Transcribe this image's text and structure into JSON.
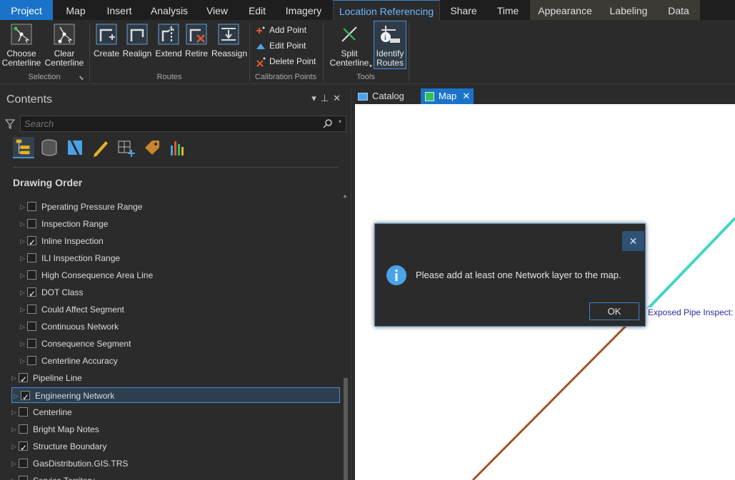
{
  "ribbon_tabs": [
    "Project",
    "Map",
    "Insert",
    "Analysis",
    "View",
    "Edit",
    "Imagery",
    "Location Referencing",
    "Share",
    "Time",
    "Appearance",
    "Labeling",
    "Data"
  ],
  "ribbon": {
    "selection": {
      "label": "Selection",
      "choose_centerline": "Choose\nCenterline",
      "clear_centerline": "Clear\nCenterline"
    },
    "routes": {
      "label": "Routes",
      "create": "Create",
      "realign": "Realign",
      "extend": "Extend",
      "retire": "Retire",
      "reassign": "Reassign"
    },
    "calibration": {
      "label": "Calibration Points",
      "add_point": "Add Point",
      "edit_point": "Edit Point",
      "delete_point": "Delete Point"
    },
    "tools": {
      "label": "Tools",
      "split_centerline": "Split\nCenterline",
      "identify_routes": "Identify\nRoutes"
    }
  },
  "contents": {
    "title": "Contents",
    "search_placeholder": "Search",
    "drawing_order": "Drawing Order",
    "layers": [
      {
        "name": "Pperating Pressure Range",
        "checked": false,
        "indent": 1
      },
      {
        "name": "Inspection Range",
        "checked": false,
        "indent": 1
      },
      {
        "name": "Inline Inspection",
        "checked": true,
        "indent": 1
      },
      {
        "name": "ILI Inspection Range",
        "checked": false,
        "indent": 1
      },
      {
        "name": "High Consequence Area Line",
        "checked": false,
        "indent": 1
      },
      {
        "name": "DOT Class",
        "checked": true,
        "indent": 1
      },
      {
        "name": "Could Affect Segment",
        "checked": false,
        "indent": 1
      },
      {
        "name": "Continuous Network",
        "checked": false,
        "indent": 1
      },
      {
        "name": "Consequence Segment",
        "checked": false,
        "indent": 1
      },
      {
        "name": "Centerline Accuracy",
        "checked": false,
        "indent": 1
      },
      {
        "name": "Pipeline Line",
        "checked": true,
        "indent": 0
      },
      {
        "name": "Engineering Network",
        "checked": true,
        "indent": 0,
        "selected": true
      },
      {
        "name": "Centerline",
        "checked": false,
        "indent": 0
      },
      {
        "name": "Bright Map Notes",
        "checked": false,
        "indent": 0
      },
      {
        "name": "Structure Boundary",
        "checked": true,
        "indent": 0
      },
      {
        "name": "GasDistribution.GIS.TRS",
        "checked": false,
        "indent": 0
      },
      {
        "name": "Service Territory",
        "checked": false,
        "indent": 0
      }
    ]
  },
  "view_tabs": {
    "catalog": "Catalog",
    "map": "Map"
  },
  "map": {
    "label": "Exposed Pipe Inspect:"
  },
  "dialog": {
    "message": "Please add at least one Network layer to the map.",
    "ok": "OK",
    "close_glyph": "✕"
  },
  "colors": {
    "accent": "#1a73c9",
    "pipeline_cyan": "#3fd6c6",
    "pipeline_orange": "#b8602e"
  }
}
